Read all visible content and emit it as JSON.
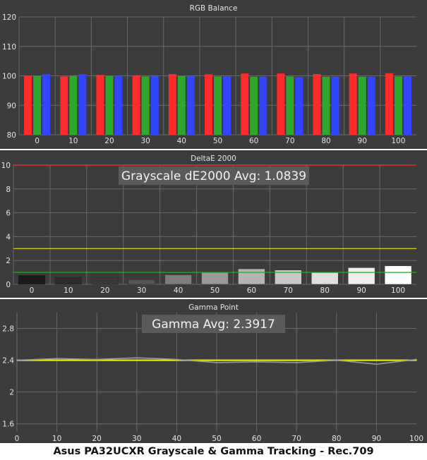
{
  "caption": "Asus PA32UCXR Grayscale & Gamma Tracking - Rec.709",
  "colors": {
    "background": "#3c3c3c",
    "grid": "#6a6a6a",
    "text": "#e6e6e6",
    "red": "#ff2a2a",
    "green": "#2fa72f",
    "blue": "#3344ff",
    "delta_max_line": "#ff3030",
    "delta_warn_line": "#e6e600",
    "delta_ok_line": "#22aa22",
    "gamma_target": "#e6e600",
    "gamma_measured": "#9a9a9a"
  },
  "chart_data": [
    {
      "type": "bar",
      "title": "RGB Balance",
      "categories": [
        "0",
        "10",
        "20",
        "30",
        "40",
        "50",
        "60",
        "70",
        "80",
        "90",
        "100"
      ],
      "ylim": [
        80,
        120
      ],
      "yticks": [
        80,
        90,
        100,
        110,
        120
      ],
      "series": [
        {
          "key": "red",
          "values": [
            100.0,
            99.8,
            100.3,
            100.2,
            100.6,
            100.5,
            100.8,
            100.8,
            100.6,
            100.8,
            100.9
          ]
        },
        {
          "key": "green",
          "values": [
            100.0,
            100.1,
            99.9,
            99.8,
            99.9,
            99.8,
            99.7,
            99.8,
            99.7,
            99.7,
            99.8
          ]
        },
        {
          "key": "blue",
          "values": [
            100.6,
            100.5,
            100.0,
            99.9,
            99.9,
            99.8,
            99.7,
            99.6,
            99.7,
            99.7,
            99.8
          ]
        }
      ]
    },
    {
      "type": "bar",
      "title": "DeltaE 2000",
      "annotation": "Grayscale dE2000 Avg: 1.0839",
      "categories": [
        "0",
        "10",
        "20",
        "30",
        "40",
        "50",
        "60",
        "70",
        "80",
        "90",
        "100"
      ],
      "ylim": [
        0,
        10
      ],
      "yticks": [
        0,
        2,
        4,
        6,
        8,
        10
      ],
      "values": [
        0.75,
        0.6,
        0.55,
        0.4,
        0.8,
        1.0,
        1.3,
        1.2,
        1.0,
        1.4,
        1.55
      ],
      "bar_shades": [
        "#1a1a1a",
        "#2b2b2b",
        "#3a3a3a",
        "#555555",
        "#7d7d7d",
        "#999999",
        "#b4b4b4",
        "#c8c8c8",
        "#dedede",
        "#eeeeee",
        "#ffffff"
      ],
      "reference_lines": [
        {
          "value": 10,
          "key": "delta_max_line"
        },
        {
          "value": 3,
          "key": "delta_warn_line"
        },
        {
          "value": 1,
          "key": "delta_ok_line"
        }
      ]
    },
    {
      "type": "line",
      "title": "Gamma Point",
      "annotation": "Gamma Avg: 2.3917",
      "x": [
        0,
        10,
        20,
        30,
        40,
        50,
        60,
        70,
        80,
        90,
        100
      ],
      "xlim": [
        0,
        100
      ],
      "ylim": [
        1.5,
        3.0
      ],
      "yticks": [
        1.6,
        2,
        2.4,
        2.8
      ],
      "series": [
        {
          "key": "gamma_target",
          "values": [
            2.4,
            2.4,
            2.4,
            2.4,
            2.4,
            2.4,
            2.4,
            2.4,
            2.4,
            2.4,
            2.4
          ]
        },
        {
          "key": "gamma_measured",
          "values": [
            2.4,
            2.42,
            2.41,
            2.43,
            2.41,
            2.37,
            2.38,
            2.37,
            2.4,
            2.35,
            2.41
          ]
        }
      ]
    }
  ]
}
